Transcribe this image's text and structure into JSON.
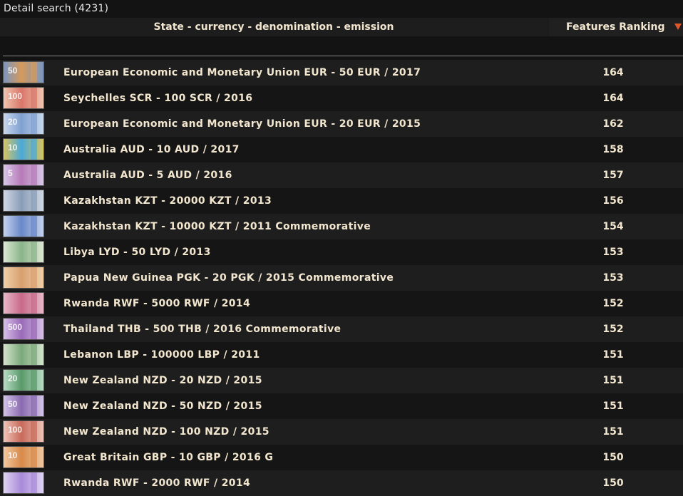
{
  "search": {
    "title": "Detail search (4231)"
  },
  "table": {
    "col_state": "State - currency - denomination - emission",
    "col_rank": "Features Ranking",
    "rows": [
      {
        "label": "European Economic and Monetary Union EUR - 50 EUR / 2017",
        "rank": "164",
        "thumb": {
          "color": "#d59a5a",
          "accent": "#7a96c2",
          "num": "50"
        }
      },
      {
        "label": "Seychelles SCR - 100 SCR / 2016",
        "rank": "164",
        "thumb": {
          "color": "#d9766a",
          "accent": "#f0c6b0",
          "num": "100"
        }
      },
      {
        "label": "European Economic and Monetary Union EUR - 20 EUR / 2015",
        "rank": "162",
        "thumb": {
          "color": "#7fa0d0",
          "accent": "#c8d8ee",
          "num": "20"
        }
      },
      {
        "label": "Australia AUD - 10 AUD / 2017",
        "rank": "158",
        "thumb": {
          "color": "#4aa9d8",
          "accent": "#d8c460",
          "num": "10"
        }
      },
      {
        "label": "Australia AUD - 5 AUD / 2016",
        "rank": "157",
        "thumb": {
          "color": "#b77ab8",
          "accent": "#d8c8e8",
          "num": "5"
        }
      },
      {
        "label": "Kazakhstan KZT - 20000 KZT / 2013",
        "rank": "156",
        "thumb": {
          "color": "#8a9db8",
          "accent": "#d0d8e4",
          "num": ""
        }
      },
      {
        "label": "Kazakhstan KZT - 10000 KZT / 2011 Commemorative",
        "rank": "154",
        "thumb": {
          "color": "#6a88c8",
          "accent": "#c4d2ee",
          "num": ""
        }
      },
      {
        "label": "Libya LYD - 50 LYD / 2013",
        "rank": "153",
        "thumb": {
          "color": "#8ab48a",
          "accent": "#dce8d4",
          "num": ""
        }
      },
      {
        "label": "Papua New Guinea PGK - 20 PGK / 2015 Commemorative",
        "rank": "153",
        "thumb": {
          "color": "#d8a070",
          "accent": "#f0d0a8",
          "num": ""
        }
      },
      {
        "label": "Rwanda RWF - 5000 RWF / 2014",
        "rank": "152",
        "thumb": {
          "color": "#c86a8a",
          "accent": "#e8b8c8",
          "num": ""
        }
      },
      {
        "label": "Thailand THB - 500 THB / 2016 Commemorative",
        "rank": "152",
        "thumb": {
          "color": "#9a6ab8",
          "accent": "#d8c0e8",
          "num": "500"
        }
      },
      {
        "label": "Lebanon LBP - 100000 LBP / 2011",
        "rank": "151",
        "thumb": {
          "color": "#7aa87a",
          "accent": "#d4e4cc",
          "num": ""
        }
      },
      {
        "label": "New Zealand NZD - 20 NZD / 2015",
        "rank": "151",
        "thumb": {
          "color": "#5a9a6a",
          "accent": "#b8dcc4",
          "num": "20"
        }
      },
      {
        "label": "New Zealand NZD - 50 NZD / 2015",
        "rank": "151",
        "thumb": {
          "color": "#8a6ab0",
          "accent": "#d4c4e8",
          "num": "50"
        }
      },
      {
        "label": "New Zealand NZD - 100 NZD / 2015",
        "rank": "151",
        "thumb": {
          "color": "#c86a5a",
          "accent": "#eec4b8",
          "num": "100"
        }
      },
      {
        "label": "Great Britain GBP - 10 GBP / 2016 G",
        "rank": "150",
        "thumb": {
          "color": "#d88a4a",
          "accent": "#f0c8a0",
          "num": "10"
        }
      },
      {
        "label": "Rwanda RWF - 2000 RWF / 2014",
        "rank": "150",
        "thumb": {
          "color": "#a88ad8",
          "accent": "#e0d4f4",
          "num": ""
        }
      }
    ]
  }
}
